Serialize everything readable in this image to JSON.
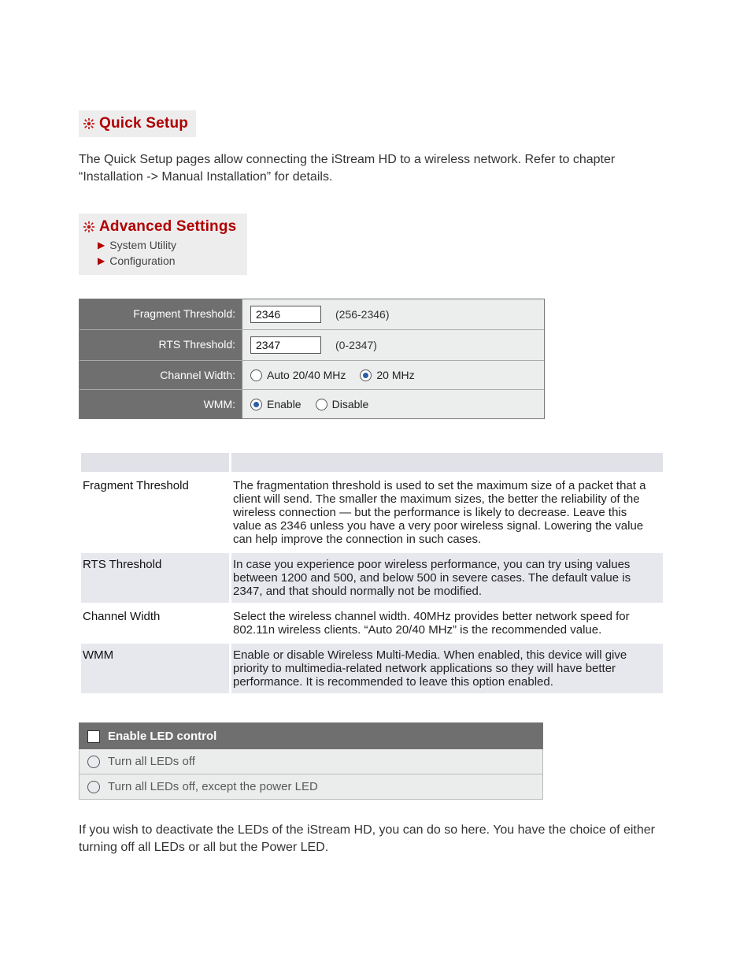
{
  "sections": {
    "quick_setup_title": "Quick Setup",
    "advanced_title": "Advanced Settings",
    "subnav": {
      "system_utility": "System Utility",
      "configuration": "Configuration"
    }
  },
  "intro_text": "The Quick Setup pages allow connecting the iStream HD to a wireless network. Refer to chapter “Installation -> Manual Installation” for details.",
  "settings": {
    "fragment": {
      "label": "Fragment Threshold:",
      "value": "2346",
      "range": "(256-2346)"
    },
    "rts": {
      "label": "RTS Threshold:",
      "value": "2347",
      "range": "(0-2347)"
    },
    "channel_width": {
      "label": "Channel Width:",
      "opt_auto": "Auto 20/40 MHz",
      "opt_20": "20 MHz",
      "selected": "20"
    },
    "wmm": {
      "label": "WMM:",
      "opt_enable": "Enable",
      "opt_disable": "Disable",
      "selected": "enable"
    }
  },
  "descriptions": {
    "fragment": {
      "key": "Fragment Threshold",
      "text": "The fragmentation threshold is used to set the maximum size of a packet that a client will send. The smaller the maximum sizes, the better the reliability of the wireless connection — but the performance is likely to decrease. Leave this value as 2346 unless you have a very poor wireless signal. Lowering the value can help improve the connection in such cases."
    },
    "rts": {
      "key": "RTS Threshold",
      "text": "In case you experience poor wireless performance, you can try using values between 1200 and 500, and below 500 in severe cases. The default value is 2347, and that should normally not be modified."
    },
    "channel_width": {
      "key": "Channel Width",
      "text": "Select the wireless channel width. 40MHz provides better network speed for 802.11n wireless clients. “Auto 20/40 MHz” is the recommended value."
    },
    "wmm": {
      "key": "WMM",
      "text": "Enable or disable Wireless Multi-Media. When enabled, this device will give priority to multimedia-related network applications so they will have better performance. It is recommended to leave this option enabled."
    }
  },
  "led": {
    "header": "Enable LED control",
    "opt_all_off": "Turn all LEDs off",
    "opt_except_power": "Turn all LEDs off, except the power LED",
    "master_checked": false
  },
  "led_text": "If you wish to deactivate the LEDs of the iStream HD, you can do so here. You have the choice of either turning off all LEDs or all but the Power LED."
}
